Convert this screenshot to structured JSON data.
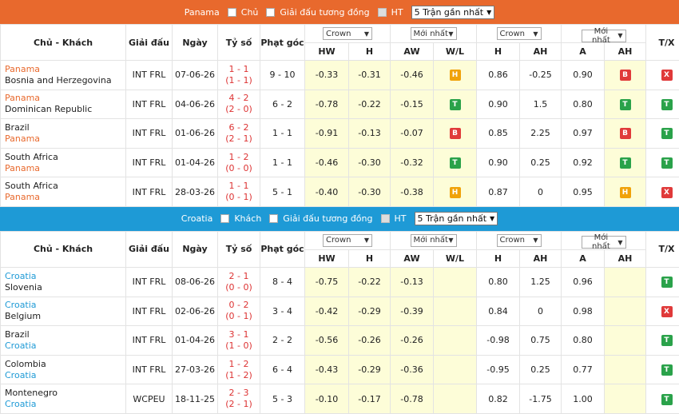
{
  "sections": [
    {
      "team": "Panama",
      "home_label": "Chủ",
      "same_league": "Giải đấu tương đồng",
      "ht": "HT",
      "recent": "5 Trận gần nhất",
      "rows": [
        {
          "home": "Panama",
          "away": "Bosnia and Herzegovina",
          "highlight": "home",
          "league": "INT FRL",
          "date": "07-06-26",
          "score": "1 - 1",
          "ht": "(1 - 1)",
          "corner": "9 - 10",
          "hw": "-0.33",
          "h": "-0.31",
          "aw": "-0.46",
          "wl": "H",
          "h2": "0.86",
          "ah": "-0.25",
          "a": "0.90",
          "ah2": "B",
          "tx": "X"
        },
        {
          "home": "Panama",
          "away": "Dominican Republic",
          "highlight": "home",
          "league": "INT FRL",
          "date": "04-06-26",
          "score": "4 - 2",
          "ht": "(2 - 0)",
          "corner": "6 - 2",
          "hw": "-0.78",
          "h": "-0.22",
          "aw": "-0.15",
          "wl": "T",
          "h2": "0.90",
          "ah": "1.5",
          "a": "0.80",
          "ah2": "T",
          "tx": "T"
        },
        {
          "home": "Brazil",
          "away": "Panama",
          "highlight": "away",
          "league": "INT FRL",
          "date": "01-06-26",
          "score": "6 - 2",
          "ht": "(2 - 1)",
          "corner": "1 - 1",
          "hw": "-0.91",
          "h": "-0.13",
          "aw": "-0.07",
          "wl": "B",
          "h2": "0.85",
          "ah": "2.25",
          "a": "0.97",
          "ah2": "B",
          "tx": "T"
        },
        {
          "home": "South Africa",
          "away": "Panama",
          "highlight": "away",
          "league": "INT FRL",
          "date": "01-04-26",
          "score": "1 - 2",
          "ht": "(0 - 0)",
          "corner": "1 - 1",
          "hw": "-0.46",
          "h": "-0.30",
          "aw": "-0.32",
          "wl": "T",
          "h2": "0.90",
          "ah": "0.25",
          "a": "0.92",
          "ah2": "T",
          "tx": "T"
        },
        {
          "home": "South Africa",
          "away": "Panama",
          "highlight": "away",
          "league": "INT FRL",
          "date": "28-03-26",
          "score": "1 - 1",
          "ht": "(0 - 1)",
          "corner": "5 - 1",
          "hw": "-0.40",
          "h": "-0.30",
          "aw": "-0.38",
          "wl": "H",
          "h2": "0.87",
          "ah": "0",
          "a": "0.95",
          "ah2": "H",
          "tx": "X"
        }
      ]
    },
    {
      "team": "Croatia",
      "home_label": "Khách",
      "same_league": "Giải đấu tương đồng",
      "ht": "HT",
      "recent": "5 Trận gần nhất",
      "rows": [
        {
          "home": "Croatia",
          "away": "Slovenia",
          "highlight": "home",
          "league": "INT FRL",
          "date": "08-06-26",
          "score": "2 - 1",
          "ht": "(0 - 0)",
          "corner": "8 - 4",
          "hw": "-0.75",
          "h": "-0.22",
          "aw": "-0.13",
          "wl": "",
          "h2": "0.80",
          "ah": "1.25",
          "a": "0.96",
          "ah2": "",
          "tx": "T"
        },
        {
          "home": "Croatia",
          "away": "Belgium",
          "highlight": "home",
          "league": "INT FRL",
          "date": "02-06-26",
          "score": "0 - 2",
          "ht": "(0 - 1)",
          "corner": "3 - 4",
          "hw": "-0.42",
          "h": "-0.29",
          "aw": "-0.39",
          "wl": "",
          "h2": "0.84",
          "ah": "0",
          "a": "0.98",
          "ah2": "",
          "tx": "X"
        },
        {
          "home": "Brazil",
          "away": "Croatia",
          "highlight": "away",
          "league": "INT FRL",
          "date": "01-04-26",
          "score": "3 - 1",
          "ht": "(1 - 0)",
          "corner": "2 - 2",
          "hw": "-0.56",
          "h": "-0.26",
          "aw": "-0.26",
          "wl": "",
          "h2": "-0.98",
          "ah": "0.75",
          "a": "0.80",
          "ah2": "",
          "tx": "T"
        },
        {
          "home": "Colombia",
          "away": "Croatia",
          "highlight": "away",
          "league": "INT FRL",
          "date": "27-03-26",
          "score": "1 - 2",
          "ht": "(1 - 2)",
          "corner": "6 - 4",
          "hw": "-0.43",
          "h": "-0.29",
          "aw": "-0.36",
          "wl": "",
          "h2": "-0.95",
          "ah": "0.25",
          "a": "0.77",
          "ah2": "",
          "tx": "T"
        },
        {
          "home": "Montenegro",
          "away": "Croatia",
          "highlight": "away",
          "league": "WCPEU",
          "date": "18-11-25",
          "score": "2 - 3",
          "ht": "(2 - 1)",
          "corner": "5 - 3",
          "hw": "-0.10",
          "h": "-0.17",
          "aw": "-0.78",
          "wl": "",
          "h2": "0.82",
          "ah": "-1.75",
          "a": "1.00",
          "ah2": "",
          "tx": "T"
        }
      ]
    }
  ],
  "headers": {
    "teams": "Chủ - Khách",
    "league": "Giải đấu",
    "date": "Ngày",
    "score": "Tỷ số",
    "corner": "Phạt góc",
    "crown": "Crown",
    "latest": "Mới nhất",
    "tx": "T/X",
    "hw": "HW",
    "h": "H",
    "aw": "AW",
    "wl": "W/L",
    "h2": "H",
    "ah": "AH",
    "a": "A",
    "ah2": "AH"
  },
  "colors": {
    "orange": "#e8692d",
    "blue": "#1e9ad6",
    "win": "#2aa24a",
    "loss": "#e03a3a",
    "draw": "#f0a20a"
  }
}
